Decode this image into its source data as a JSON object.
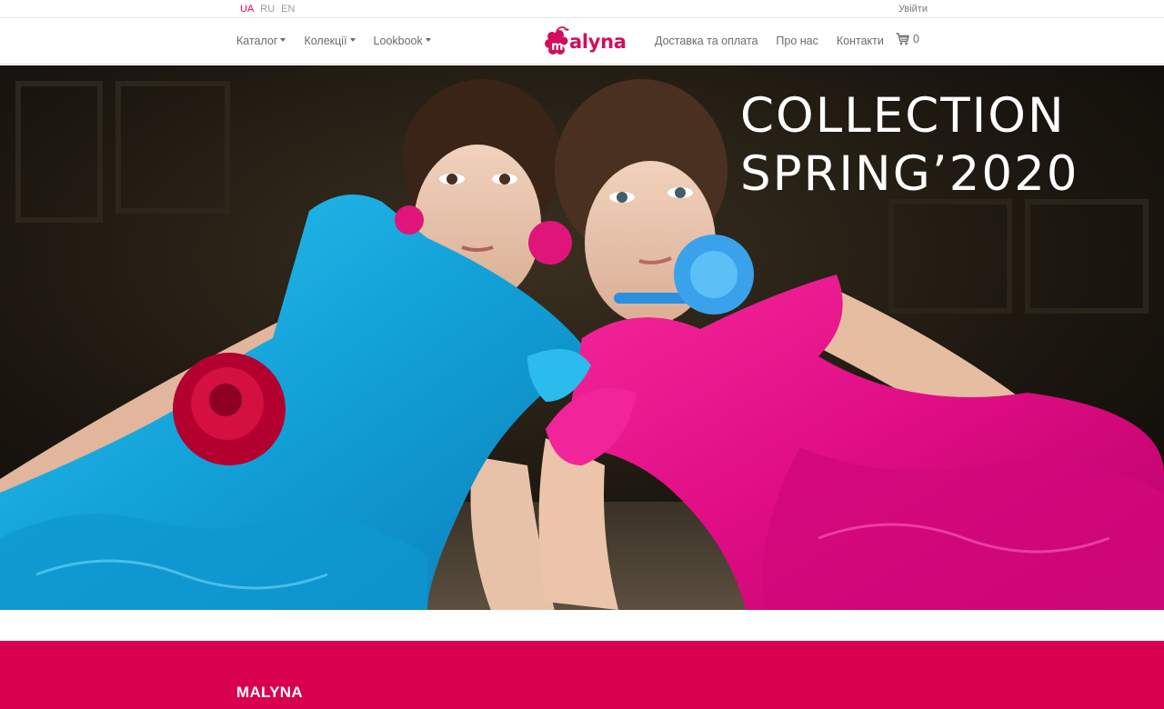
{
  "topbar": {
    "languages": [
      {
        "code": "UA",
        "active": true
      },
      {
        "code": "RU",
        "active": false
      },
      {
        "code": "EN",
        "active": false
      }
    ],
    "login_label": "Увійти"
  },
  "nav": {
    "left": [
      {
        "label": "Каталог"
      },
      {
        "label": "Колекції"
      },
      {
        "label": "Lookbook"
      }
    ],
    "logo_text": "alyna",
    "logo_letter": "m",
    "right": [
      {
        "label": "Доставка та оплата"
      },
      {
        "label": "Про нас"
      },
      {
        "label": "Контакти"
      }
    ],
    "cart_count": "0",
    "cart_icon": "shopping-cart-icon"
  },
  "hero": {
    "title_line1": "COLLECTION",
    "title_line2": "SPRING’2020"
  },
  "footer": {
    "brand": "MALYNA"
  },
  "colors": {
    "brand": "#d8004f",
    "active_lang": "#e0005e",
    "blue_dress": "#19a9dc",
    "pink_dress": "#e8108a"
  }
}
